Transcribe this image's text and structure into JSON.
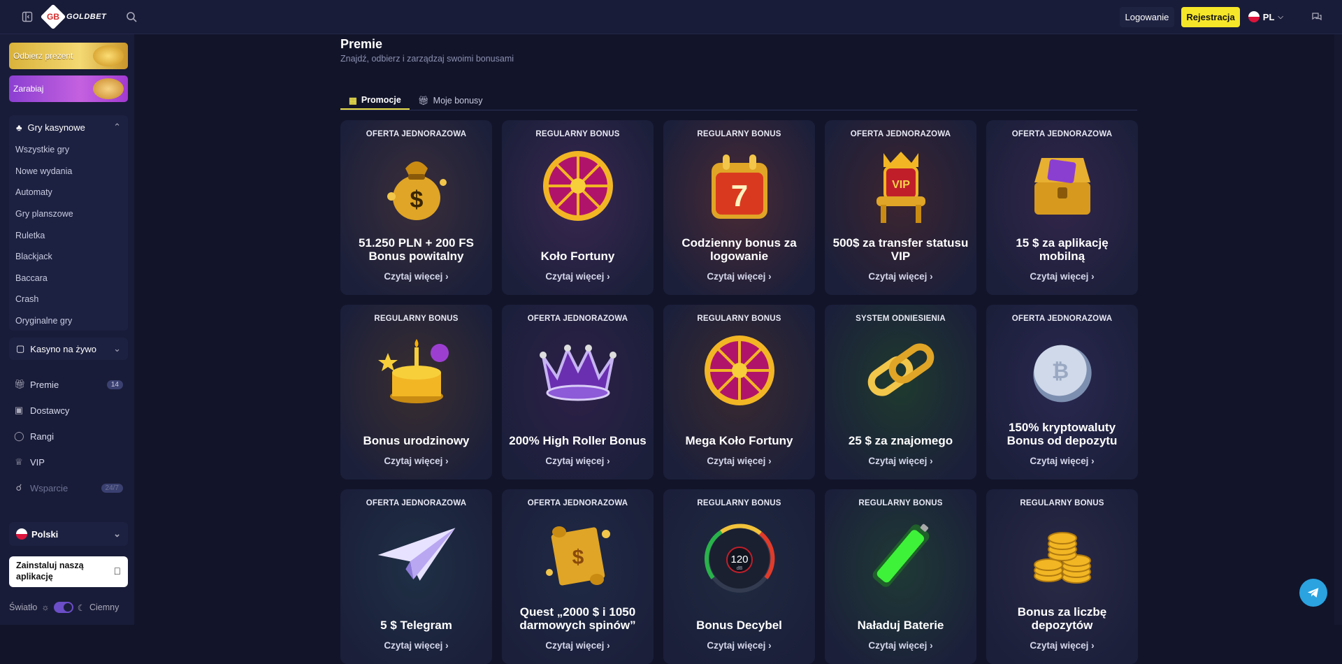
{
  "topbar": {
    "logo_text": "GOLDBET",
    "logo_badge": "GB",
    "login_label": "Logowanie",
    "register_label": "Rejestracja",
    "lang_code": "PL"
  },
  "sidebar": {
    "promo_gift": "Odbierz prezent",
    "promo_earn": "Zarabiaj",
    "casino_games": {
      "label": "Gry kasynowe",
      "items": [
        "Wszystkie gry",
        "Nowe wydania",
        "Automaty",
        "Gry planszowe",
        "Ruletka",
        "Blackjack",
        "Baccara",
        "Crash",
        "Oryginalne gry"
      ]
    },
    "live_casino": "Kasyno na żywo",
    "links": {
      "bonuses": "Premie",
      "bonuses_count": "14",
      "providers": "Dostawcy",
      "ranks": "Rangi",
      "vip": "VIP",
      "support": "Wsparcie",
      "support_badge": "24/7"
    },
    "language": "Polski",
    "install_app": "Zainstaluj naszą aplikację",
    "theme_light": "Światło",
    "theme_dark": "Ciemny"
  },
  "main": {
    "title": "Premie",
    "subtitle": "Znajdź, odbierz i zarządzaj swoimi bonusami",
    "tabs": [
      "Promocje",
      "Moje bonusy"
    ],
    "read_more": "Czytaj więcej",
    "cards": [
      {
        "label": "OFERTA JEDNORAZOWA",
        "title": "51.250 PLN + 200 FS Bonus powitalny",
        "art": "money-bag-icon",
        "bg": "#3a2e3a"
      },
      {
        "label": "REGULARNY BONUS",
        "title": "Koło Fortuny",
        "art": "wheel-icon",
        "bg": "#3a2750"
      },
      {
        "label": "REGULARNY BONUS",
        "title": "Codzienny bonus za logowanie",
        "art": "calendar-icon",
        "bg": "#4a2a35"
      },
      {
        "label": "OFERTA JEDNORAZOWA",
        "title": "500$ za transfer statusu VIP",
        "art": "throne-icon",
        "bg": "#3d2530"
      },
      {
        "label": "OFERTA JEDNORAZOWA",
        "title": "15 $ za aplikację mobilną",
        "art": "chest-icon",
        "bg": "#33264a"
      },
      {
        "label": "REGULARNY BONUS",
        "title": "Bonus urodzinowy",
        "art": "cake-icon",
        "bg": "#3a2e30"
      },
      {
        "label": "OFERTA JEDNORAZOWA",
        "title": "200% High Roller Bonus",
        "art": "crown-icon",
        "bg": "#2e2148"
      },
      {
        "label": "REGULARNY BONUS",
        "title": "Mega Koło Fortuny",
        "art": "wheel-icon",
        "bg": "#3a2a30"
      },
      {
        "label": "SYSTEM ODNIESIENIA",
        "title": "25 $ za znajomego",
        "art": "chain-icon",
        "bg": "#1f3a2e"
      },
      {
        "label": "OFERTA JEDNORAZOWA",
        "title": "150% kryptowaluty Bonus od depozytu",
        "art": "coin-icon",
        "bg": "#2a2850"
      },
      {
        "label": "OFERTA JEDNORAZOWA",
        "title": "5 $ Telegram",
        "art": "plane-icon",
        "bg": "#1f3045"
      },
      {
        "label": "OFERTA JEDNORAZOWA",
        "title": "Quest „2000 $ i 1050 darmowych spinów”",
        "art": "scroll-icon",
        "bg": "#1f2a45"
      },
      {
        "label": "REGULARNY BONUS",
        "title": "Bonus Decybel",
        "art": "gauge-icon",
        "bg": "#1f2a40"
      },
      {
        "label": "REGULARNY BONUS",
        "title": "Naładuj Baterie",
        "art": "battery-icon",
        "bg": "#1f3a35"
      },
      {
        "label": "REGULARNY BONUS",
        "title": "Bonus za liczbę depozytów",
        "art": "coins-icon",
        "bg": "#2a2a45"
      }
    ],
    "gauge_value": "120",
    "gauge_unit": "dB"
  },
  "colors": {
    "accent_yellow": "#f5e62a",
    "background": "#12142a",
    "sidebar": "#191c38"
  }
}
